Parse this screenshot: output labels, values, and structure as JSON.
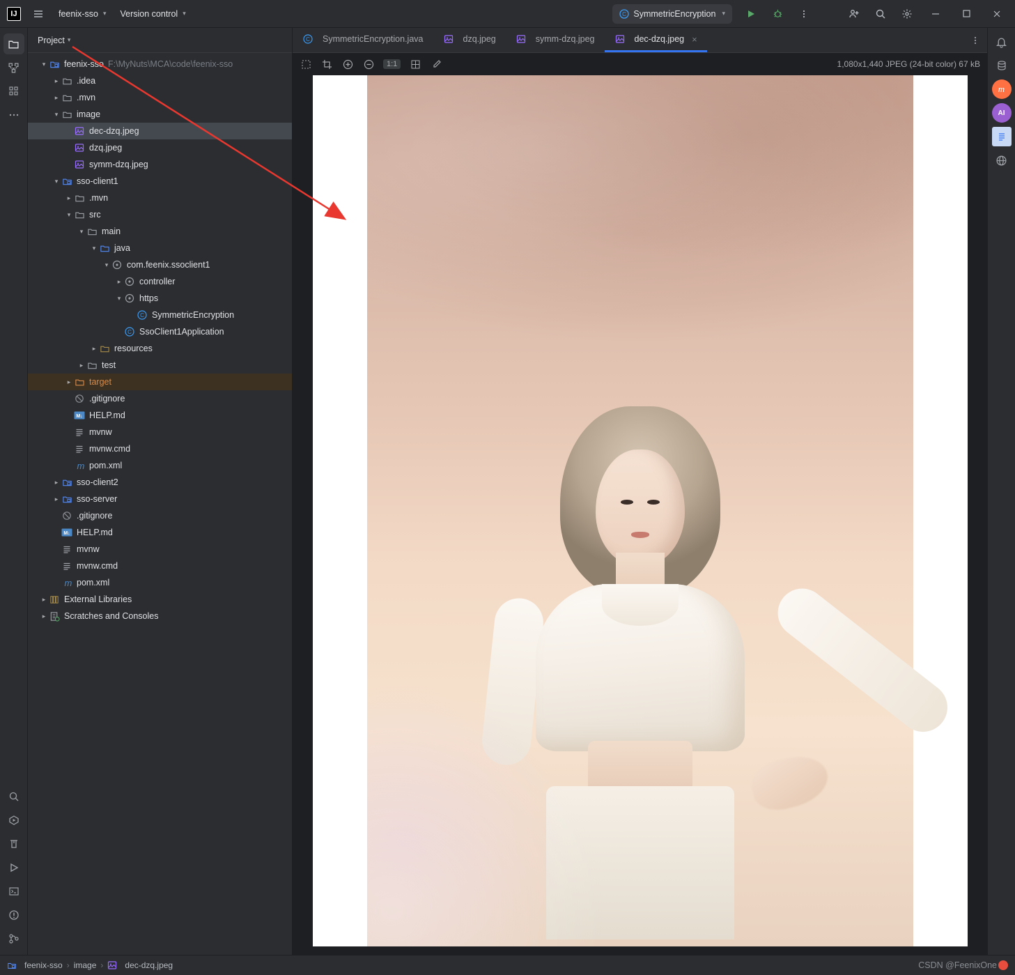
{
  "titlebar": {
    "logo": "IJ",
    "project": "feenix-sso",
    "vcs": "Version control",
    "run_config": "SymmetricEncryption"
  },
  "left_stripe": {
    "top": [
      "folder-icon",
      "structure-icon",
      "grid-icon",
      "more-icon"
    ],
    "bottom": [
      "search-icon",
      "services-icon",
      "build-icon",
      "run-icon",
      "terminal-icon",
      "problems-icon",
      "git-icon"
    ]
  },
  "right_stripe": {
    "items": [
      "notifications-icon",
      "database-icon",
      "maven-icon",
      "ai-icon",
      "notes-icon",
      "http-icon"
    ]
  },
  "project_header": "Project",
  "tree": [
    {
      "d": 0,
      "a": "v",
      "icon": "module",
      "label": "feenix-sso",
      "sub": "F:\\MyNuts\\MCA\\code\\feenix-sso"
    },
    {
      "d": 1,
      "a": ">",
      "icon": "folder",
      "label": ".idea"
    },
    {
      "d": 1,
      "a": ">",
      "icon": "folder",
      "label": ".mvn"
    },
    {
      "d": 1,
      "a": "v",
      "icon": "folder",
      "label": "image"
    },
    {
      "d": 2,
      "a": "",
      "icon": "image",
      "label": "dec-dzq.jpeg",
      "sel": true
    },
    {
      "d": 2,
      "a": "",
      "icon": "image",
      "label": "dzq.jpeg"
    },
    {
      "d": 2,
      "a": "",
      "icon": "image",
      "label": "symm-dzq.jpeg"
    },
    {
      "d": 1,
      "a": "v",
      "icon": "module",
      "label": "sso-client1"
    },
    {
      "d": 2,
      "a": ">",
      "icon": "folder",
      "label": ".mvn"
    },
    {
      "d": 2,
      "a": "v",
      "icon": "folder",
      "label": "src"
    },
    {
      "d": 3,
      "a": "v",
      "icon": "folder",
      "label": "main"
    },
    {
      "d": 4,
      "a": "v",
      "icon": "src-folder",
      "label": "java"
    },
    {
      "d": 5,
      "a": "v",
      "icon": "package",
      "label": "com.feenix.ssoclient1"
    },
    {
      "d": 6,
      "a": ">",
      "icon": "package",
      "label": "controller"
    },
    {
      "d": 6,
      "a": "v",
      "icon": "package",
      "label": "https"
    },
    {
      "d": 7,
      "a": "",
      "icon": "class",
      "label": "SymmetricEncryption"
    },
    {
      "d": 6,
      "a": "",
      "icon": "class",
      "label": "SsoClient1Application"
    },
    {
      "d": 4,
      "a": ">",
      "icon": "res-folder",
      "label": "resources"
    },
    {
      "d": 3,
      "a": ">",
      "icon": "folder",
      "label": "test"
    },
    {
      "d": 2,
      "a": ">",
      "icon": "target",
      "label": "target",
      "cls": "orange",
      "mark": true
    },
    {
      "d": 2,
      "a": "",
      "icon": "ignore",
      "label": ".gitignore"
    },
    {
      "d": 2,
      "a": "",
      "icon": "md",
      "label": "HELP.md"
    },
    {
      "d": 2,
      "a": "",
      "icon": "text",
      "label": "mvnw"
    },
    {
      "d": 2,
      "a": "",
      "icon": "text",
      "label": "mvnw.cmd"
    },
    {
      "d": 2,
      "a": "",
      "icon": "maven",
      "label": "pom.xml"
    },
    {
      "d": 1,
      "a": ">",
      "icon": "module",
      "label": "sso-client2"
    },
    {
      "d": 1,
      "a": ">",
      "icon": "module",
      "label": "sso-server"
    },
    {
      "d": 1,
      "a": "",
      "icon": "ignore",
      "label": ".gitignore"
    },
    {
      "d": 1,
      "a": "",
      "icon": "md",
      "label": "HELP.md"
    },
    {
      "d": 1,
      "a": "",
      "icon": "text",
      "label": "mvnw"
    },
    {
      "d": 1,
      "a": "",
      "icon": "text",
      "label": "mvnw.cmd"
    },
    {
      "d": 1,
      "a": "",
      "icon": "maven",
      "label": "pom.xml"
    },
    {
      "d": 0,
      "a": ">",
      "icon": "lib",
      "label": "External Libraries"
    },
    {
      "d": 0,
      "a": ">",
      "icon": "scratch",
      "label": "Scratches and Consoles"
    }
  ],
  "tabs": [
    {
      "icon": "class",
      "label": "SymmetricEncryption.java"
    },
    {
      "icon": "image",
      "label": "dzq.jpeg"
    },
    {
      "icon": "image",
      "label": "symm-dzq.jpeg"
    },
    {
      "icon": "image",
      "label": "dec-dzq.jpeg",
      "active": true,
      "close": true
    }
  ],
  "image_toolbar": {
    "zoom_label": "1:1",
    "info": "1,080x1,440 JPEG (24-bit color) 67 kB"
  },
  "breadcrumbs": [
    {
      "icon": "module",
      "label": "feenix-sso"
    },
    {
      "icon": "",
      "label": "image"
    },
    {
      "icon": "image",
      "label": "dec-dzq.jpeg"
    }
  ],
  "watermark": "CSDN @FeenixOne"
}
